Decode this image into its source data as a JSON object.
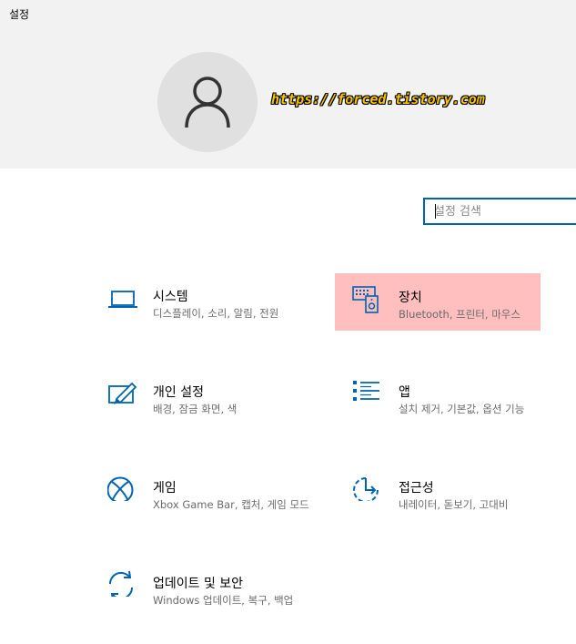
{
  "app": {
    "title": "설정"
  },
  "header": {
    "watermark": "https://forced.tistory.com"
  },
  "search": {
    "placeholder": "설정 검색"
  },
  "categories": [
    {
      "name": "시스템",
      "desc": "디스플레이, 소리, 알림, 전원",
      "icon": "laptop-icon"
    },
    {
      "name": "장치",
      "desc": "Bluetooth, 프린터, 마우스",
      "icon": "devices-icon"
    },
    {
      "name": "개인 설정",
      "desc": "배경, 잠금 화면, 색",
      "icon": "personalization-icon"
    },
    {
      "name": "앱",
      "desc": "설치 제거, 기본값, 옵션 기능",
      "icon": "apps-list-icon"
    },
    {
      "name": "게임",
      "desc": "Xbox Game Bar, 캡처, 게임 모드",
      "icon": "xbox-icon"
    },
    {
      "name": "접근성",
      "desc": "내레이터, 돋보기, 고대비",
      "icon": "ease-of-access-icon"
    },
    {
      "name": "업데이트 및 보안",
      "desc": "Windows 업데이트, 복구, 백업",
      "icon": "update-sync-icon"
    }
  ],
  "colors": {
    "accent": "#0063b1",
    "highlight": "#ffbfbf",
    "header_bg": "#f2f2f2"
  }
}
